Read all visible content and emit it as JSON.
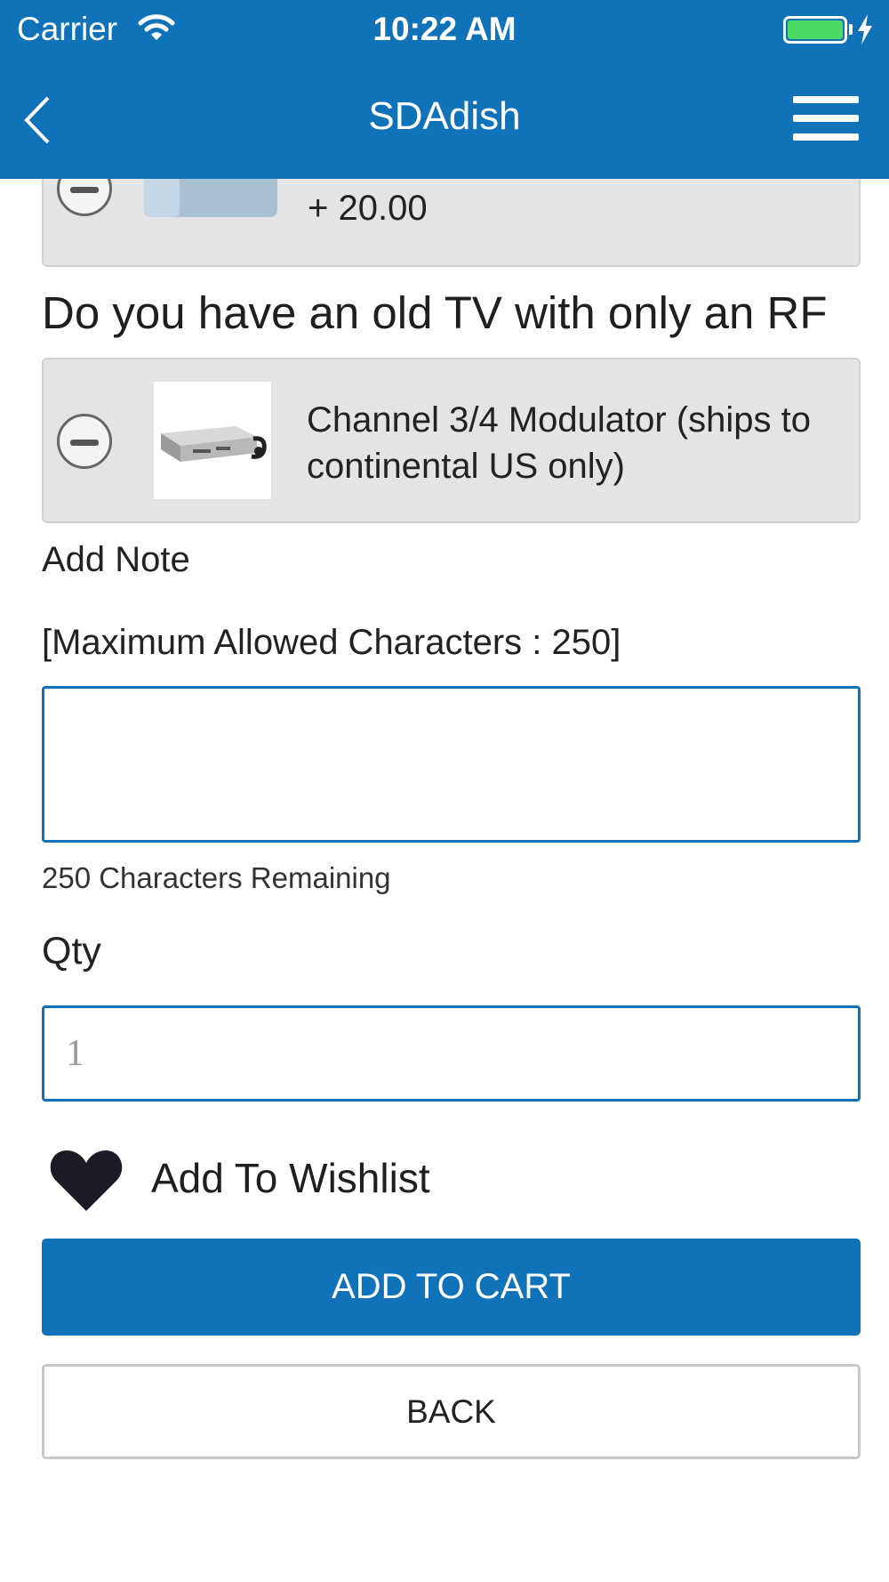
{
  "status_bar": {
    "carrier": "Carrier",
    "time": "10:22 AM",
    "battery_color": "#4cd964"
  },
  "header": {
    "title": "SDAdish",
    "background": "#1072b8",
    "back_icon": "chevron-left-icon",
    "menu_icon": "hamburger-menu-icon"
  },
  "options": [
    {
      "price": "+ 20.00",
      "icon": "minus-circle-icon"
    },
    {
      "label": "Channel 3/4 Modulator (ships to continental US only)",
      "icon": "minus-circle-icon"
    }
  ],
  "question": "Do you have an old TV with only an RF",
  "note": {
    "label": "Add Note",
    "max_label": "[Maximum Allowed Characters : 250]",
    "value": "",
    "remaining": "250 Characters Remaining"
  },
  "qty": {
    "label": "Qty",
    "placeholder": "1"
  },
  "wishlist": {
    "label": "Add To Wishlist",
    "icon": "heart-icon"
  },
  "buttons": {
    "add_to_cart": "ADD TO CART",
    "back": "BACK"
  }
}
